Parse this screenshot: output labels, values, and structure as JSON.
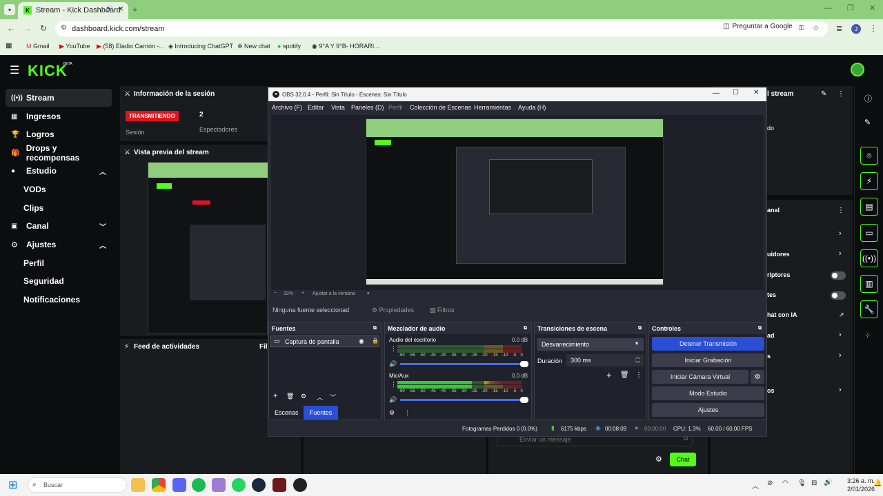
{
  "browser": {
    "tab_title": "Stream - Kick Dashboard",
    "url": "dashboard.kick.com/stream",
    "ask_google": "Preguntar a Google",
    "avatar_letter": "J",
    "bookmarks": [
      "Gmail",
      "YouTube",
      "(58) Eladio Carrión -...",
      "Introducing ChatGPT",
      "New chat",
      "spotify",
      "9°A Y 9°B- HORARI..."
    ]
  },
  "kick": {
    "logo": "KICK",
    "beta": "BETA",
    "sidebar": [
      {
        "label": "Stream"
      },
      {
        "label": "Ingresos"
      },
      {
        "label": "Logros"
      },
      {
        "label": "Drops y recompensas"
      },
      {
        "label": "Estudio"
      },
      {
        "label": "VODs"
      },
      {
        "label": "Clips"
      },
      {
        "label": "Canal"
      },
      {
        "label": "Ajustes"
      },
      {
        "label": "Perfil"
      },
      {
        "label": "Seguridad"
      },
      {
        "label": "Notificaciones"
      }
    ],
    "session_title": "Información de la sesión",
    "live_badge": "TRANSMITIENDO",
    "session_label": "Sesión",
    "viewers_count": "2",
    "viewers_label": "Espectadores",
    "preview_title": "Vista previa del stream",
    "feed_title": "Feed de actividades",
    "feed_partial": "Fil",
    "right_stream": "l stream",
    "right_do": "do",
    "right_canal": "anal",
    "right_items": [
      "uidores",
      "riptores",
      "tes",
      "hat con IA",
      "ad",
      "s",
      "os"
    ],
    "chat_placeholder": "Enviar un mensaje",
    "chat_button": "Chat"
  },
  "obs": {
    "title": "OBS 32.0.4 - Perfil: Sin Título - Escenas: Sin Título",
    "menu": [
      "Archivo (F)",
      "Editar",
      "Vista",
      "Paneles (D)",
      "Perfil",
      "Colección de Escenas",
      "Herramientas",
      "Ayuda (H)"
    ],
    "zoom": "33%",
    "fit": "Ajustar a la ventana",
    "no_source": "Ninguna fuente seleccionad",
    "properties": "Propiedades",
    "filters": "Filtros",
    "sources_title": "Fuentes",
    "source_item": "Captura de pantalla",
    "tab_scenes": "Escenas",
    "tab_sources": "Fuentes",
    "mixer_title": "Mezclador de audio",
    "desktop_audio": "Audio del escritorio",
    "desktop_db": "0.0 dB",
    "mic": "Mic/Aux",
    "mic_db": "0.0 dB",
    "ticks": [
      "-60",
      "-55",
      "-50",
      "-45",
      "-40",
      "-35",
      "-30",
      "-25",
      "-20",
      "-15",
      "-10",
      "-5",
      "0"
    ],
    "transitions_title": "Transiciones de escena",
    "transition_value": "Desvanecimiento",
    "duration_label": "Duración",
    "duration_value": "300 ms",
    "controls_title": "Controles",
    "controls": [
      "Detener Transmisión",
      "Iniciar Grabación",
      "Iniciar Cámara Virtual",
      "Modo Estudio",
      "Ajustes"
    ],
    "status_frames": "Fotogramas Perdidos 0 (0.0%)",
    "status_kbps": "6175 kbps",
    "status_stream": "00:08:09",
    "status_rec": "00:00:00",
    "status_cpu": "CPU: 1.3%",
    "status_fps": "60.00 / 60.00 FPS"
  },
  "taskbar": {
    "search": "Buscar",
    "time": "3:26 a. m.",
    "date": "2/01/2026"
  }
}
